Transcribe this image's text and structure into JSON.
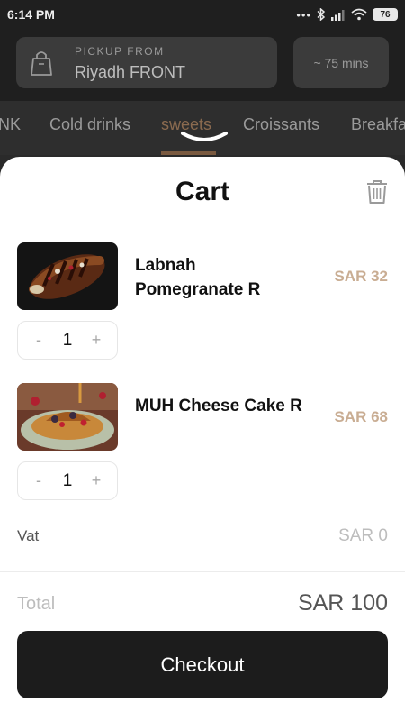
{
  "statusbar": {
    "time": "6:14 PM",
    "icons": [
      "more-dots-icon",
      "bluetooth-icon",
      "signal-icon",
      "wifi-icon",
      "battery-icon"
    ],
    "battery": "76"
  },
  "header": {
    "pickup_label": "PICKUP FROM",
    "pickup_value": "Riyadh FRONT",
    "time_estimate": "~ 75 mins"
  },
  "categories": {
    "items": [
      "NK",
      "Cold drinks",
      "sweets",
      "Croissants",
      "Breakfa"
    ],
    "active": "sweets"
  },
  "cart": {
    "title": "Cart",
    "items": [
      {
        "name": "Labnah Pomegranate R",
        "price": "SAR 32",
        "quantity": "1",
        "minus": "-",
        "plus": "+"
      },
      {
        "name": "MUH Cheese Cake R",
        "price": "SAR 68",
        "quantity": "1",
        "minus": "-",
        "plus": "+"
      }
    ],
    "vat_label": "Vat",
    "vat_value": "SAR 0",
    "total_label": "Total",
    "total_value": "SAR 100",
    "checkout_label": "Checkout"
  },
  "colors": {
    "accent_price": "#c9ad93",
    "active_category": "#8a6a4f",
    "checkout_bg": "#1c1c1c"
  }
}
